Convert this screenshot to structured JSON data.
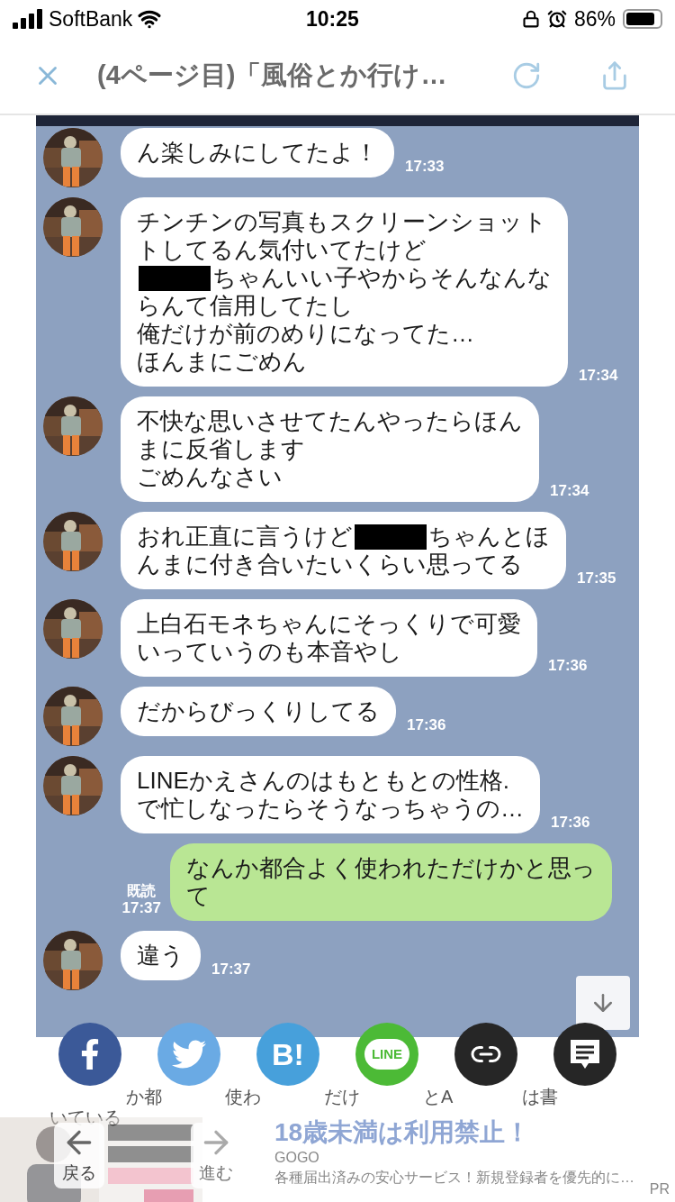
{
  "status_bar": {
    "carrier": "SoftBank",
    "time": "10:25",
    "battery": "86%"
  },
  "nav_bar": {
    "title": "(4ページ目)「風俗とか行け…"
  },
  "chat": {
    "messages": [
      {
        "kind": "received",
        "lines": [
          "ん楽しみにしてたよ！"
        ],
        "time": "17:33"
      },
      {
        "kind": "received",
        "lines": [
          "チンチンの写真もスクリーンショット",
          "トしてるん気付いてたけど",
          [
            {
              "kind": "redaction"
            },
            {
              "kind": "text",
              "text": "ちゃんいい子やからそんなんな"
            }
          ],
          "らんて信用してたし",
          "俺だけが前のめりになってた…",
          "ほんまにごめん"
        ],
        "time": "17:34"
      },
      {
        "kind": "received",
        "lines": [
          "不快な思いさせてたんやったらほん",
          "まに反省します",
          "ごめんなさい"
        ],
        "time": "17:34"
      },
      {
        "kind": "received",
        "lines": [
          [
            {
              "kind": "text",
              "text": "おれ正直に言うけど"
            },
            {
              "kind": "redaction"
            },
            {
              "kind": "text",
              "text": "ちゃんとほ"
            }
          ],
          "んまに付き合いたいくらい思ってる"
        ],
        "time": "17:35"
      },
      {
        "kind": "received",
        "lines": [
          "上白石モネちゃんにそっくりで可愛",
          "いっていうのも本音やし"
        ],
        "time": "17:36"
      },
      {
        "kind": "received",
        "lines": [
          "だからびっくりしてる"
        ],
        "time": "17:36"
      },
      {
        "kind": "received",
        "lines": [
          "LINEかえさんのはもともとの性格.",
          "で忙しなったらそうなっちゃうの…"
        ],
        "time": "17:36"
      },
      {
        "kind": "sent",
        "lines": [
          "なんか都合よく使われただけかと思っ",
          "て"
        ],
        "read": "既読",
        "time": "17:37"
      },
      {
        "kind": "received",
        "lines": [
          "違う"
        ],
        "time": "17:37"
      }
    ]
  },
  "share_buttons": [
    {
      "kind": "facebook"
    },
    {
      "kind": "twitter"
    },
    {
      "kind": "hatena",
      "label": "B!"
    },
    {
      "kind": "line",
      "label": "LINE"
    },
    {
      "kind": "link"
    },
    {
      "kind": "comment"
    }
  ],
  "article": {
    "fragments": [
      "か都",
      "使わ",
      "だけ",
      "とA",
      "は書"
    ],
    "line_2": "いている"
  },
  "ad": {
    "title": "18歳未満は利用禁止！",
    "source": "GOGO",
    "description": "各種届出済みの安心サービス！新規登録者を優先的に…",
    "badge": "PR"
  },
  "toolbar": {
    "back": "戻る",
    "forward": "進む"
  }
}
